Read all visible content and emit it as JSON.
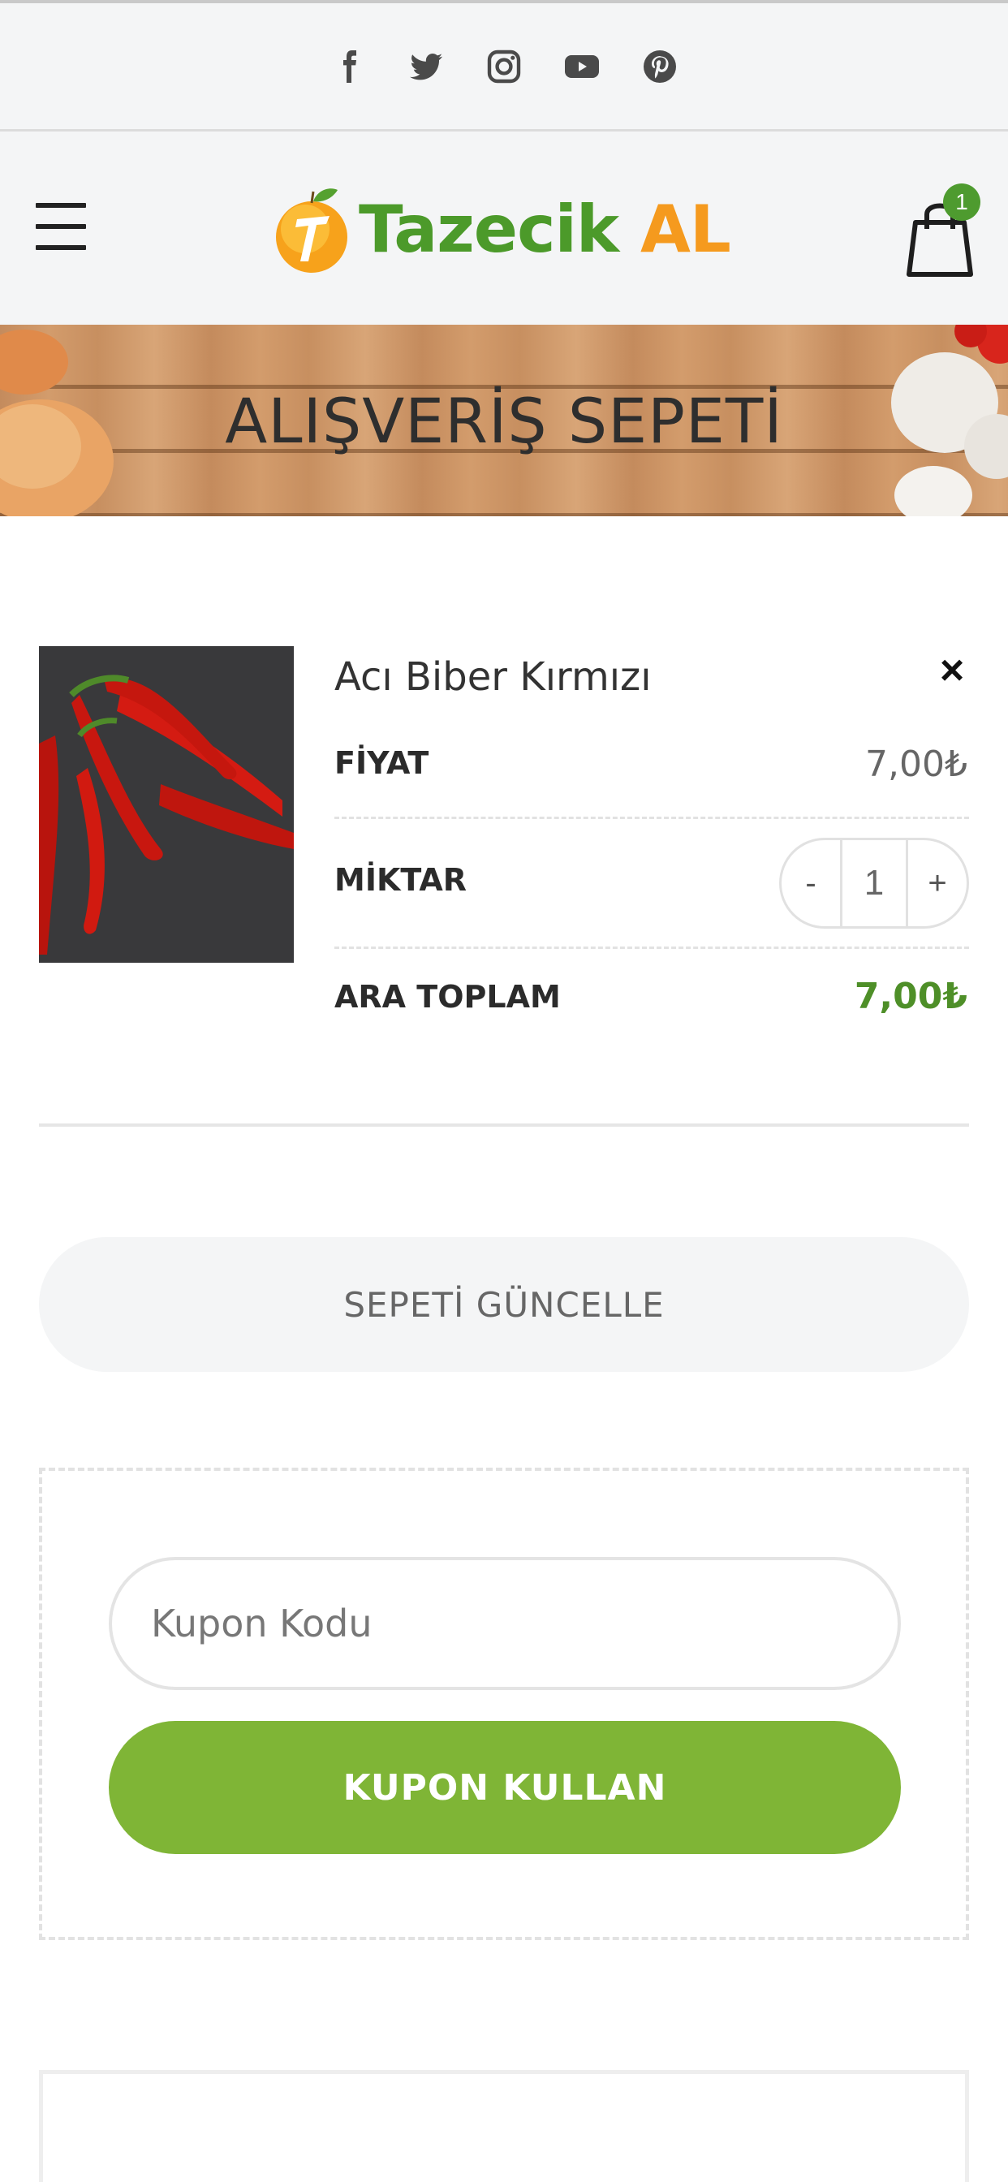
{
  "social": [
    "facebook-icon",
    "twitter-icon",
    "instagram-icon",
    "youtube-icon",
    "pinterest-icon"
  ],
  "header": {
    "logo_text_green": "Tazecik",
    "logo_text_orange": "AL",
    "cart_count": "1"
  },
  "banner": {
    "title": "ALIŞVERİŞ SEPETİ"
  },
  "item": {
    "name": "Acı Biber Kırmızı",
    "remove_label": "×",
    "price_label": "FİYAT",
    "price_value": "7,00₺",
    "qty_label": "MİKTAR",
    "qty_minus": "-",
    "qty_value": "1",
    "qty_plus": "+",
    "subtotal_label": "ARA TOPLAM",
    "subtotal_value": "7,00₺"
  },
  "update_button": "SEPETİ GÜNCELLE",
  "coupon": {
    "placeholder": "Kupon Kodu",
    "apply_label": "KUPON KULLAN"
  },
  "colors": {
    "brand_green": "#7fb536",
    "total_green": "#4e8f28",
    "badge_green": "#4e9b2f",
    "logo_orange": "#f59a1e"
  }
}
